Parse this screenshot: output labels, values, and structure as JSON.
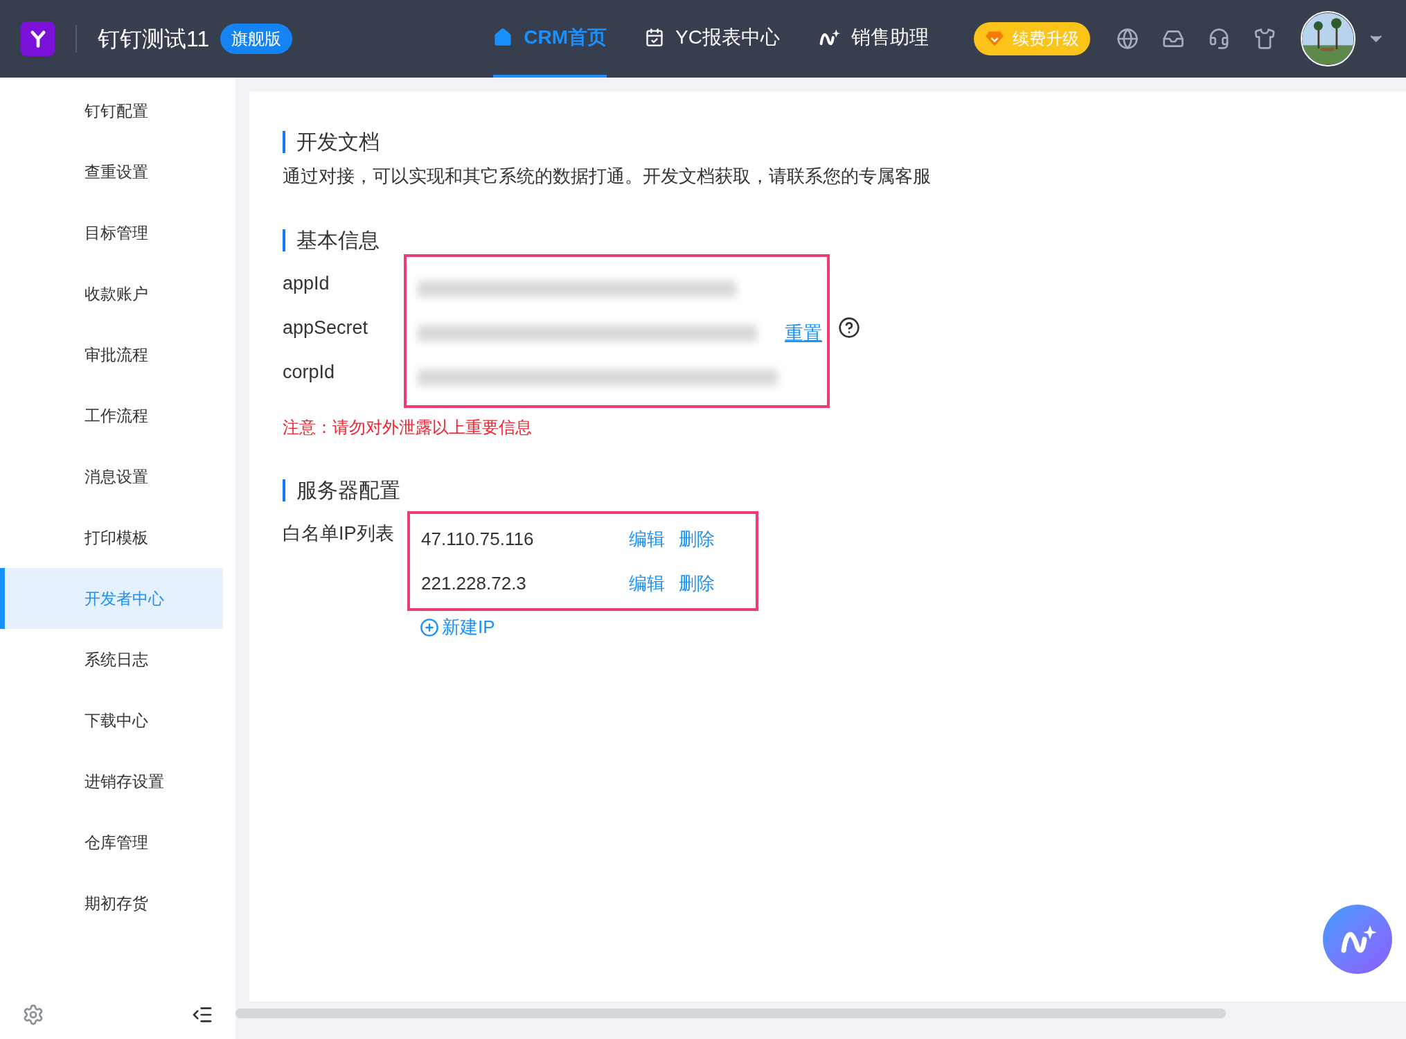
{
  "header": {
    "org_name": "钉钉测试11",
    "edition_badge": "旗舰版",
    "nav": [
      {
        "label": "CRM首页",
        "kind": "home",
        "selected": true
      },
      {
        "label": "YC报表中心",
        "kind": "report",
        "selected": false
      },
      {
        "label": "销售助理",
        "kind": "assistant",
        "selected": false
      }
    ],
    "upgrade_button": "续费升级"
  },
  "sidebar": {
    "items": [
      {
        "label": "钉钉配置",
        "selected": false
      },
      {
        "label": "查重设置",
        "selected": false
      },
      {
        "label": "目标管理",
        "selected": false
      },
      {
        "label": "收款账户",
        "selected": false
      },
      {
        "label": "审批流程",
        "selected": false
      },
      {
        "label": "工作流程",
        "selected": false
      },
      {
        "label": "消息设置",
        "selected": false
      },
      {
        "label": "打印模板",
        "selected": false
      },
      {
        "label": "开发者中心",
        "selected": true
      },
      {
        "label": "系统日志",
        "selected": false
      },
      {
        "label": "下载中心",
        "selected": false
      },
      {
        "label": "进销存设置",
        "selected": false
      },
      {
        "label": "仓库管理",
        "selected": false
      },
      {
        "label": "期初存货",
        "selected": false
      }
    ]
  },
  "dev_docs": {
    "title": "开发文档",
    "description": "通过对接，可以实现和其它系统的数据打通。开发文档获取，请联系您的专属客服"
  },
  "basic_info": {
    "title": "基本信息",
    "fields": [
      {
        "label": "appId"
      },
      {
        "label": "appSecret",
        "action": "重置"
      },
      {
        "label": "corpId"
      }
    ],
    "warning": "注意：请勿对外泄露以上重要信息"
  },
  "server_config": {
    "title": "服务器配置",
    "whitelist_label": "白名单IP列表",
    "ips": [
      {
        "ip": "47.110.75.116",
        "edit": "编辑",
        "delete": "删除"
      },
      {
        "ip": "221.228.72.3",
        "edit": "编辑",
        "delete": "删除"
      }
    ],
    "add_button": "新建IP"
  }
}
